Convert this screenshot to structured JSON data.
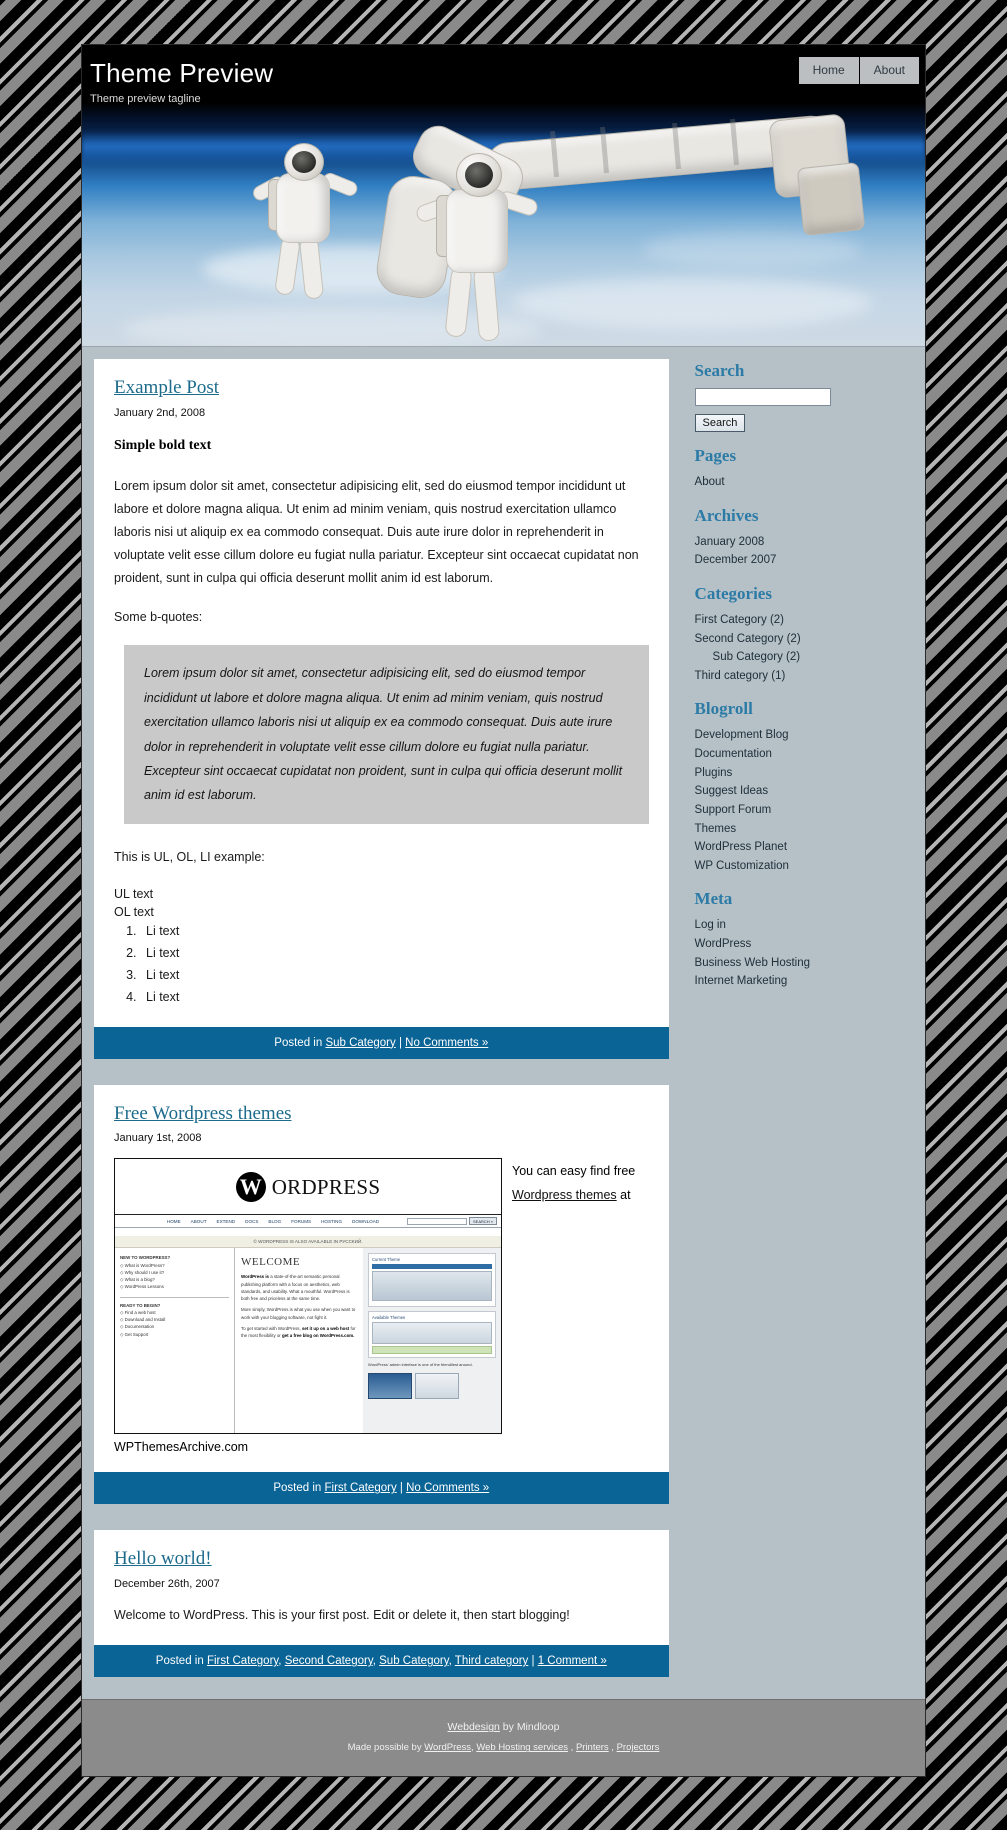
{
  "header": {
    "site_title": "Theme Preview",
    "tagline": "Theme preview tagline",
    "nav": [
      {
        "label": "Home"
      },
      {
        "label": "About"
      }
    ]
  },
  "posts": [
    {
      "title": "Example Post",
      "date": "January 2nd, 2008",
      "bold_text": "Simple bold text",
      "paragraph": "Lorem ipsum dolor sit amet, consectetur adipisicing elit, sed do eiusmod tempor incididunt ut labore et dolore magna aliqua. Ut enim ad minim veniam, quis nostrud exercitation ullamco laboris nisi ut aliquip ex ea commodo consequat. Duis aute irure dolor in reprehenderit in voluptate velit esse cillum dolore eu fugiat nulla pariatur. Excepteur sint occaecat cupidatat non proident, sunt in culpa qui officia deserunt mollit anim id est laborum.",
      "quote_intro": "Some b-quotes:",
      "blockquote": "Lorem ipsum dolor sit amet, consectetur adipisicing elit, sed do eiusmod tempor incididunt ut labore et dolore magna aliqua. Ut enim ad minim veniam, quis nostrud exercitation ullamco laboris nisi ut aliquip ex ea commodo consequat. Duis aute irure dolor in reprehenderit in voluptate velit esse cillum dolore eu fugiat nulla pariatur. Excepteur sint occaecat cupidatat non proident, sunt in culpa qui officia deserunt mollit anim id est laborum.",
      "list_intro": "This is UL, OL, LI example:",
      "ul_text": "UL text",
      "ol_text": "OL text",
      "li_items": [
        "Li text",
        "Li text",
        "Li text",
        "Li text"
      ],
      "meta": {
        "posted_in_label": "Posted in",
        "categories": [
          "Sub Category"
        ],
        "separator": "|",
        "comments": "No Comments »"
      }
    },
    {
      "title": "Free Wordpress themes",
      "date": "January 1st, 2008",
      "caption_before": "You can easy find free ",
      "caption_link": "Wordpress themes",
      "caption_after": " at",
      "image_source": "WPThemesArchive.com",
      "meta": {
        "posted_in_label": "Posted in",
        "categories": [
          "First Category"
        ],
        "separator": "|",
        "comments": "No Comments »"
      }
    },
    {
      "title": "Hello world!",
      "date": "December 26th, 2007",
      "paragraph": "Welcome to WordPress. This is your first post. Edit or delete it, then start blogging!",
      "meta": {
        "posted_in_label": "Posted in",
        "categories": [
          "First Category",
          "Second Category",
          "Sub Category",
          "Third category"
        ],
        "separator": "|",
        "comments": "1 Comment »"
      }
    }
  ],
  "wp_screenshot": {
    "logo_letter": "W",
    "logo_word": "ORDPRESS",
    "nav": [
      "HOME",
      "ABOUT",
      "EXTEND",
      "DOCS",
      "BLOG",
      "FORUMS",
      "HOSTING",
      "DOWNLOAD"
    ],
    "search_button": "SEARCH »",
    "russian_notice": "© WORDPRESS IS ALSO AVAILABLE IN РУССКИЙ.",
    "welcome_heading": "WELCOME",
    "left_heading": "NEW TO WORDPRESS?",
    "left_links": [
      "◇ What is WordPress?",
      "◇ Why should I use it?",
      "◇ What is a blog?",
      "◇ WordPress Lessons"
    ],
    "left_heading2": "READY TO BEGIN?",
    "left_links2": [
      "◇ Find a web host",
      "◇ Download and Install",
      "◇ Documentation",
      "◇ Get Support"
    ],
    "mid_p1_lead": "WordPress is",
    "mid_p1": " a state-of-the-art semantic personal publishing platform with a focus on aesthetics, web standards, and usability. What a mouthful. WordPress is both free and priceless at the same time.",
    "mid_p2": "More simply, WordPress is what you use when you want to work with your blogging software, not fight it.",
    "mid_p3_lead": "To get started with WordPress, ",
    "mid_p3_bold": "set it up on a web host",
    "mid_p3_mid": " for the most flexibility or ",
    "mid_p3_bold2": "get a free blog on WordPress.com.",
    "right_heading": "Current Theme",
    "right_heading2": "Available Themes",
    "right_caption": "WordPress' admin interface is one of the friendliest around."
  },
  "sidebar": {
    "search": {
      "heading": "Search",
      "input_value": "",
      "button_label": "Search"
    },
    "pages": {
      "heading": "Pages",
      "items": [
        "About"
      ]
    },
    "archives": {
      "heading": "Archives",
      "items": [
        "January 2008",
        "December 2007"
      ]
    },
    "categories": {
      "heading": "Categories",
      "items": [
        {
          "label": "First Category (2)",
          "indent": false
        },
        {
          "label": "Second Category (2)",
          "indent": false
        },
        {
          "label": "Sub Category (2)",
          "indent": true
        },
        {
          "label": "Third category (1)",
          "indent": false
        }
      ]
    },
    "blogroll": {
      "heading": "Blogroll",
      "items": [
        "Development Blog",
        "Documentation",
        "Plugins",
        "Suggest Ideas",
        "Support Forum",
        "Themes",
        "WordPress Planet",
        "WP Customization"
      ]
    },
    "meta": {
      "heading": "Meta",
      "items": [
        "Log in",
        "WordPress",
        "Business Web Hosting",
        "Internet Marketing"
      ]
    }
  },
  "footer": {
    "line1_link": "Webdesign",
    "line1_rest": " by Mindloop",
    "line2_prefix": "Made possible by ",
    "line2_links": [
      "WordPress",
      "Web Hosting services",
      "Printers",
      "Projectors"
    ]
  },
  "colors": {
    "meta_bar": "#0a6496",
    "heading": "#2b7ba6",
    "link": "#1d6b8c",
    "sidebar_bg": "#b6c0c7",
    "footer_bg": "#8b8b8b"
  }
}
